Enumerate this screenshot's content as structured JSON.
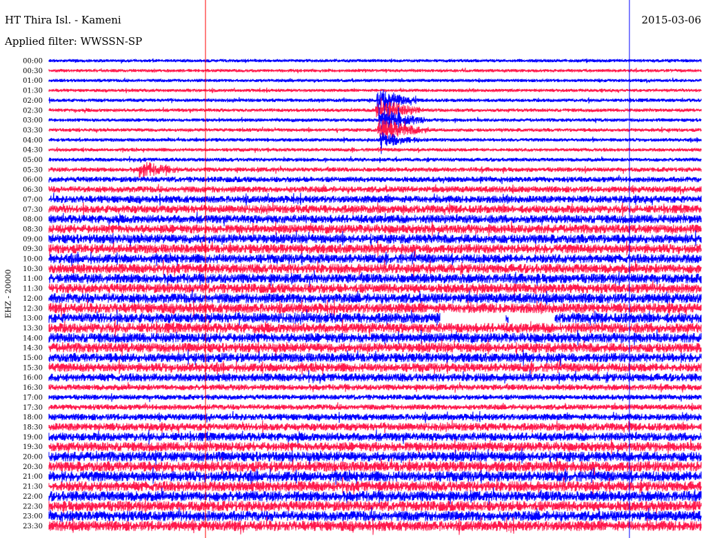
{
  "header": {
    "station": "HT Thira Isl. - Kameni",
    "date": "2015-03-06",
    "filter": "Applied filter: WWSSN-SP"
  },
  "channel_label": "EHZ - 20000",
  "colors": {
    "trace_a": "#0000ff",
    "trace_b": "#ff1a4d",
    "marker_red": "#ff0000",
    "marker_blue": "#0000ff"
  },
  "chart_data": {
    "type": "line",
    "title": "HT Thira Isl. - Kameni",
    "subtitle": "Applied filter: WWSSN-SP",
    "ylabel": "EHZ - 20000",
    "row_labels": [
      "00:00",
      "00:30",
      "01:00",
      "01:30",
      "02:00",
      "02:30",
      "03:00",
      "03:30",
      "04:00",
      "04:30",
      "05:00",
      "05:30",
      "06:00",
      "06:30",
      "07:00",
      "07:30",
      "08:00",
      "08:30",
      "09:00",
      "09:30",
      "10:00",
      "10:30",
      "11:00",
      "11:30",
      "12:00",
      "12:30",
      "13:00",
      "13:30",
      "14:00",
      "14:30",
      "15:00",
      "15:30",
      "16:00",
      "16:30",
      "17:00",
      "17:30",
      "18:00",
      "18:30",
      "19:00",
      "19:30",
      "20:00",
      "20:30",
      "21:00",
      "21:30",
      "22:00",
      "22:30",
      "23:00",
      "23:30"
    ],
    "row_colors": [
      "blue",
      "red"
    ],
    "noise_amplitude_per_row": [
      0.9,
      0.9,
      0.9,
      0.9,
      1.0,
      1.0,
      1.0,
      1.0,
      1.0,
      1.0,
      1.1,
      1.3,
      1.6,
      1.8,
      2.1,
      2.3,
      2.4,
      2.5,
      2.6,
      2.6,
      2.6,
      2.7,
      2.7,
      2.7,
      2.8,
      2.8,
      2.8,
      2.8,
      2.7,
      2.7,
      2.6,
      2.5,
      2.3,
      1.7,
      1.5,
      1.6,
      1.9,
      2.2,
      2.4,
      2.6,
      2.8,
      2.9,
      2.9,
      2.9,
      2.9,
      2.9,
      2.9,
      2.9
    ],
    "events": [
      {
        "row": "02:00",
        "x_fraction": 0.515,
        "amplitude": 6,
        "duration_fraction": 0.03
      },
      {
        "row": "02:30",
        "x_fraction": 0.515,
        "amplitude": 7,
        "duration_fraction": 0.035
      },
      {
        "row": "03:00",
        "x_fraction": 0.52,
        "amplitude": 7,
        "duration_fraction": 0.035
      },
      {
        "row": "03:30",
        "x_fraction": 0.52,
        "amplitude": 6,
        "duration_fraction": 0.04
      },
      {
        "row": "04:00",
        "x_fraction": 0.52,
        "amplitude": 4,
        "duration_fraction": 0.03
      },
      {
        "row": "05:30",
        "x_fraction": 0.15,
        "amplitude": 4,
        "duration_fraction": 0.03
      }
    ],
    "gaps": [
      {
        "row": "13:00",
        "x_fraction_start": 0.6,
        "x_fraction_end": 0.7
      },
      {
        "row": "13:00",
        "x_fraction_start": 0.705,
        "x_fraction_end": 0.775
      }
    ],
    "markers": [
      {
        "color": "red",
        "x_fraction": 0.24
      },
      {
        "color": "blue",
        "x_fraction": 0.89
      }
    ]
  }
}
